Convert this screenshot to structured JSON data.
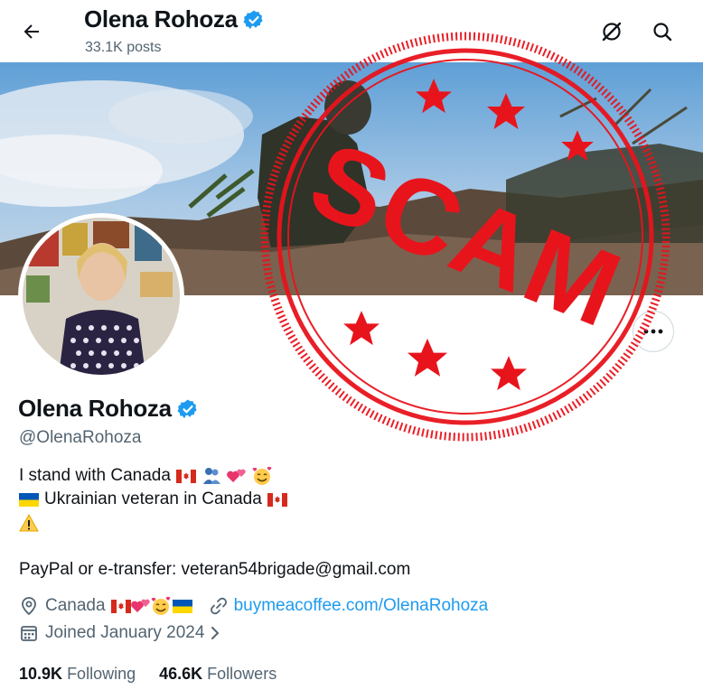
{
  "header": {
    "name": "Olena Rohoza",
    "posts": "33.1K posts"
  },
  "stamp": {
    "text": "SCAM",
    "color": "#e8141c"
  },
  "profile": {
    "name": "Olena Rohoza",
    "handle": "@OlenaRohoza",
    "bio": {
      "line1": "I stand with Canada",
      "line2": "Ukrainian veteran in Canada",
      "line4": "PayPal or e-transfer: veteran54brigade@gmail.com"
    },
    "location": "Canada",
    "website": "buymeacoffee.com/OlenaRohoza",
    "joined": "Joined January 2024",
    "following_count": "10.9K",
    "following_label": "Following",
    "followers_count": "46.6K",
    "followers_label": "Followers"
  },
  "colors": {
    "verified": "#1d9bf0",
    "link": "#1d9bf0",
    "muted": "#536471"
  },
  "icons": [
    "back-arrow-icon",
    "grok-icon",
    "search-icon",
    "more-icon",
    "verified-badge-icon",
    "location-icon",
    "link-icon",
    "calendar-icon",
    "chevron-right-icon"
  ]
}
